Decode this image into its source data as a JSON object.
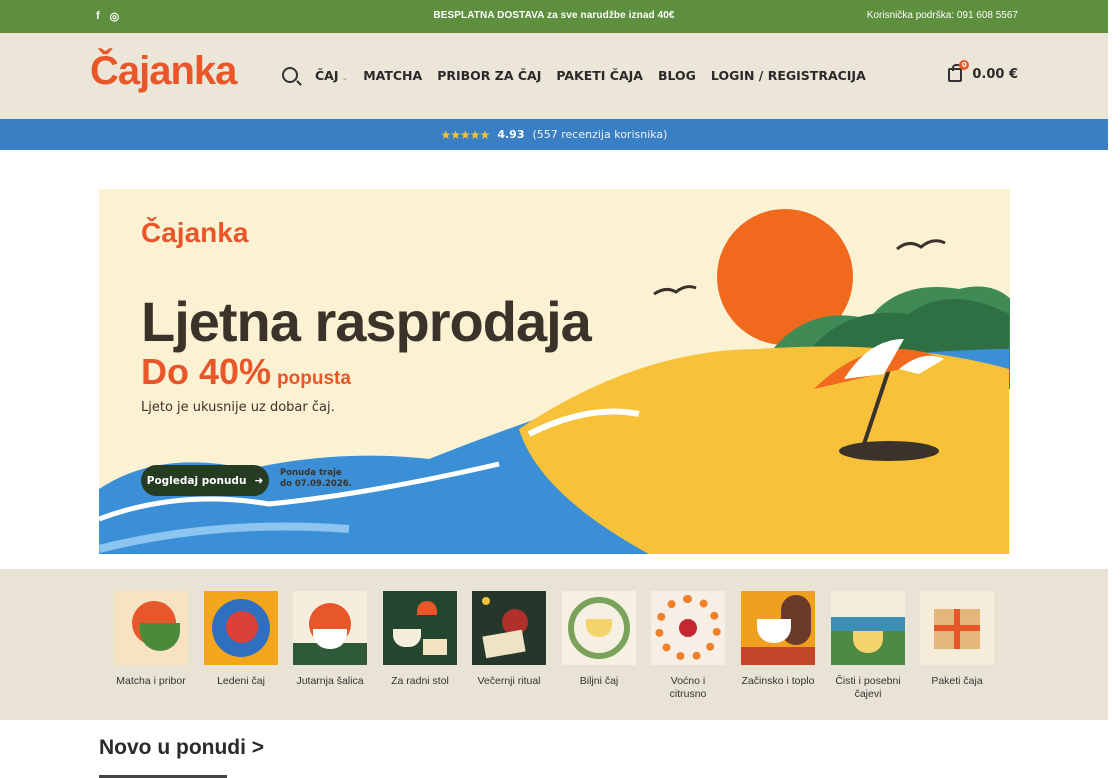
{
  "topbar": {
    "shipping": "BESPLATNA DOSTAVA za sve narudžbe iznad 40€",
    "support": "Korisnička podrška: 091 608 5567",
    "social_icons": [
      "facebook-icon",
      "instagram-icon"
    ],
    "facebook_glyph": "f",
    "instagram_glyph": "◎"
  },
  "header": {
    "logo": "Čajanka",
    "nav": [
      "ČAJ",
      "MATCHA",
      "PRIBOR ZA ČAJ",
      "PAKETI ČAJA",
      "BLOG",
      "LOGIN / REGISTRACIJA"
    ],
    "cart_total": "0.00 €",
    "cart_count": "0"
  },
  "rating": {
    "stars": "★★★★★",
    "score": "4.93",
    "count": "(557 recenzija korisnika)"
  },
  "hero": {
    "logo": "Čajanka",
    "headline": "Ljetna rasprodaja",
    "discount": "Do 40%",
    "discount_suffix": "popusta",
    "tagline": "Ljeto je ukusnije uz dobar čaj.",
    "cta": "Pogledaj ponudu",
    "cta_arrow": "➜",
    "until_line1": "Ponuda traje",
    "until_line2": "do 07.09.2026."
  },
  "categories": [
    {
      "label": "Matcha i pribor",
      "bg": "#f7e2c2"
    },
    {
      "label": "Ledeni čaj",
      "bg": "#f3a51c"
    },
    {
      "label": "Jutarnja šalica",
      "bg": "#f6eedd"
    },
    {
      "label": "Za radni stol",
      "bg": "#24462e"
    },
    {
      "label": "Večernji ritual",
      "bg": "#24372a"
    },
    {
      "label": "Biljni čaj",
      "bg": "#f6f0e3"
    },
    {
      "label": "Voćno i citrusno",
      "bg": "#f7efe6"
    },
    {
      "label": "Začinsko i toplo",
      "bg": "#f0a020"
    },
    {
      "label": "Čisti i posebni čajevi",
      "bg": "#f5ecd9"
    },
    {
      "label": "Paketi čaja",
      "bg": "#f6ecda"
    }
  ],
  "section_title": "Novo u ponudi >",
  "colors": {
    "brand": "#e8572a",
    "topbar": "#5d8f3e",
    "rating_bar": "#3a7fc3",
    "cta": "#253c22"
  }
}
